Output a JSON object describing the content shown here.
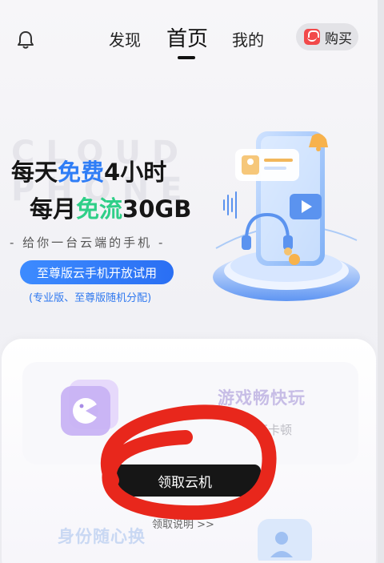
{
  "header": {
    "tabs": [
      {
        "label": "发现"
      },
      {
        "label": "首页"
      },
      {
        "label": "我的"
      }
    ],
    "buy_label": "购买",
    "icons": [
      "bell-icon",
      "shopping-bag-icon"
    ]
  },
  "hero": {
    "watermark": "CLOUD PHONE",
    "line1_prefix": "每天",
    "line1_highlight": "免费",
    "line1_suffix": "4小时",
    "line2_prefix": "每月",
    "line2_highlight": "免流",
    "line2_suffix": "30GB",
    "subtitle": "- 给你一台云端的手机 -",
    "promo_label": "至尊版云手机开放试用",
    "promo_note": "(专业版、至尊版随机分配)"
  },
  "features": {
    "game_title": "游戏畅快玩",
    "game_subtitle": "不卡顿",
    "identity_title": "身份随心换"
  },
  "cta": {
    "claim_label": "领取云机",
    "rules_label": "领取说明 >>"
  },
  "colors": {
    "accent_blue": "#2f7df6",
    "accent_green": "#2fcf88",
    "promo_pill": "#3d8bff",
    "buy_icon_red": "#f2494a",
    "scribble_red": "#e8271c"
  }
}
